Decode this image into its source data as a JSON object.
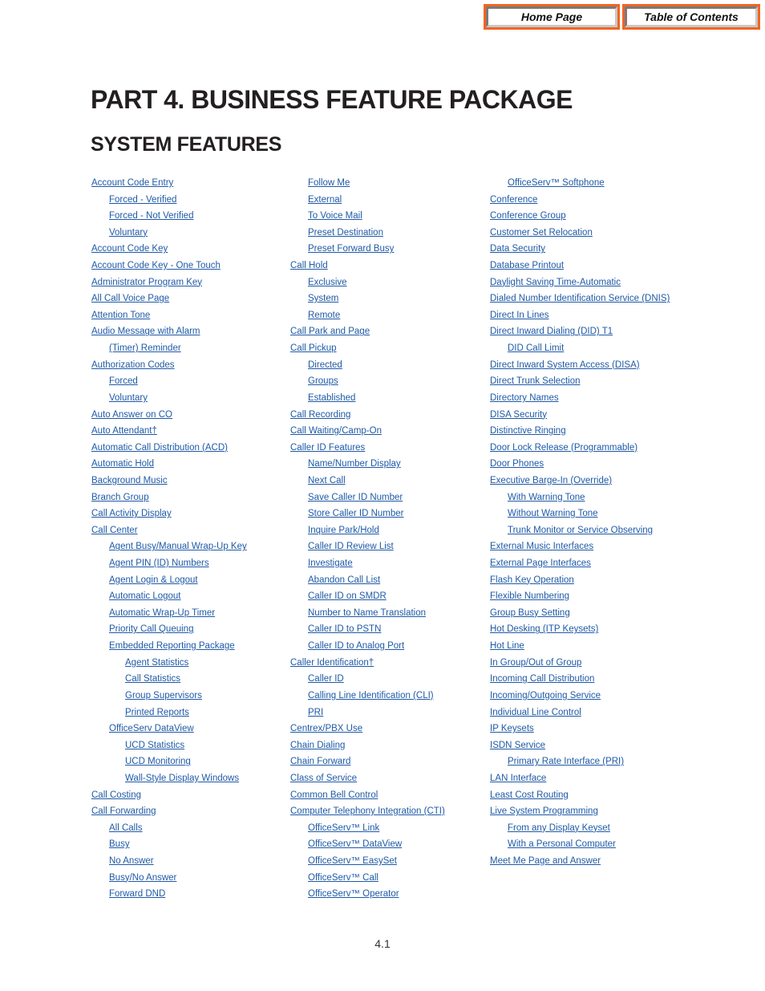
{
  "nav": {
    "home_label": "Home Page",
    "toc_label": "Table of Contents",
    "accent_color": "#f26522"
  },
  "title": "PART 4. BUSINESS FEATURE PACKAGE",
  "subtitle": "SYSTEM FEATURES",
  "link_color": "#1f5aa6",
  "columns": [
    [
      {
        "label": "Account Code Entry",
        "level": 0
      },
      {
        "label": "Forced - Verified",
        "level": 1
      },
      {
        "label": "Forced - Not Verified",
        "level": 1
      },
      {
        "label": "Voluntary",
        "level": 1
      },
      {
        "label": "Account Code Key",
        "level": 0
      },
      {
        "label": "Account Code Key - One Touch",
        "level": 0
      },
      {
        "label": "Administrator Program Key",
        "level": 0
      },
      {
        "label": "All Call Voice Page",
        "level": 0
      },
      {
        "label": "Attention Tone",
        "level": 0
      },
      {
        "label": "Audio Message with Alarm ",
        "level": 0
      },
      {
        "label": "(Timer) Reminder",
        "level": 1
      },
      {
        "label": "Authorization Codes",
        "level": 0
      },
      {
        "label": "Forced",
        "level": 1
      },
      {
        "label": "Voluntary",
        "level": 1
      },
      {
        "label": "Auto Answer on CO",
        "level": 0
      },
      {
        "label": "Auto Attendant†",
        "level": 0
      },
      {
        "label": "Automatic Call Distribution (ACD)",
        "level": 0
      },
      {
        "label": "Automatic Hold",
        "level": 0
      },
      {
        "label": "Background Music",
        "level": 0
      },
      {
        "label": "Branch Group",
        "level": 0
      },
      {
        "label": "Call Activity Display",
        "level": 0
      },
      {
        "label": "Call Center",
        "level": 0
      },
      {
        "label": "Agent Busy/Manual Wrap-Up Key",
        "level": 1
      },
      {
        "label": "Agent PIN (ID) Numbers",
        "level": 1
      },
      {
        "label": "Agent Login & Logout",
        "level": 1
      },
      {
        "label": "Automatic Logout",
        "level": 1
      },
      {
        "label": "Automatic Wrap-Up Timer",
        "level": 1
      },
      {
        "label": "Priority Call Queuing",
        "level": 1
      },
      {
        "label": "Embedded Reporting Package",
        "level": 1
      },
      {
        "label": "Agent Statistics",
        "level": 2
      },
      {
        "label": "Call Statistics",
        "level": 2
      },
      {
        "label": "Group Supervisors",
        "level": 2
      },
      {
        "label": "Printed Reports",
        "level": 2
      },
      {
        "label": "OfficeServ DataView",
        "level": 1
      },
      {
        "label": "UCD Statistics",
        "level": 2
      },
      {
        "label": "UCD Monitoring",
        "level": 2
      },
      {
        "label": "Wall-Style Display Windows",
        "level": 2
      },
      {
        "label": "Call Costing",
        "level": 0
      },
      {
        "label": "Call Forwarding",
        "level": 0
      },
      {
        "label": "All Calls",
        "level": 1
      },
      {
        "label": "Busy",
        "level": 1
      },
      {
        "label": "No Answer",
        "level": 1
      },
      {
        "label": "Busy/No Answer",
        "level": 1
      },
      {
        "label": "Forward DND",
        "level": 1
      }
    ],
    [
      {
        "label": "Follow Me",
        "level": 1
      },
      {
        "label": "External",
        "level": 1
      },
      {
        "label": "To Voice Mail",
        "level": 1
      },
      {
        "label": "Preset Destination",
        "level": 1
      },
      {
        "label": "Preset Forward Busy",
        "level": 1
      },
      {
        "label": "Call Hold",
        "level": 0
      },
      {
        "label": "Exclusive",
        "level": 1
      },
      {
        "label": "System",
        "level": 1
      },
      {
        "label": "Remote",
        "level": 1
      },
      {
        "label": "Call Park and Page",
        "level": 0
      },
      {
        "label": "Call Pickup",
        "level": 0
      },
      {
        "label": "Directed",
        "level": 1
      },
      {
        "label": "Groups",
        "level": 1
      },
      {
        "label": "Established",
        "level": 1
      },
      {
        "label": "Call Recording",
        "level": 0
      },
      {
        "label": "Call Waiting/Camp-On",
        "level": 0
      },
      {
        "label": "Caller ID Features",
        "level": 0
      },
      {
        "label": "Name/Number Display",
        "level": 1
      },
      {
        "label": "Next Call",
        "level": 1
      },
      {
        "label": "Save Caller ID Number",
        "level": 1
      },
      {
        "label": "Store Caller ID Number",
        "level": 1
      },
      {
        "label": "Inquire Park/Hold",
        "level": 1
      },
      {
        "label": "Caller ID Review List ",
        "level": 1
      },
      {
        "label": "Investigate",
        "level": 1
      },
      {
        "label": "Abandon Call List",
        "level": 1
      },
      {
        "label": "Caller ID on SMDR",
        "level": 1
      },
      {
        "label": "Number to Name Translation",
        "level": 1
      },
      {
        "label": "Caller ID to PSTN",
        "level": 1
      },
      {
        "label": "Caller ID to Analog Port",
        "level": 1
      },
      {
        "label": "Caller Identification†",
        "level": 0
      },
      {
        "label": "Caller ID",
        "level": 1
      },
      {
        "label": "Calling Line Identification (CLI)",
        "level": 1
      },
      {
        "label": "PRI",
        "level": 1
      },
      {
        "label": "Centrex/PBX Use",
        "level": 0
      },
      {
        "label": "Chain Dialing",
        "level": 0
      },
      {
        "label": "Chain Forward",
        "level": 0
      },
      {
        "label": "Class of Service",
        "level": 0
      },
      {
        "label": "Common Bell Control",
        "level": 0
      },
      {
        "label": "Computer Telephony Integration (CTI)",
        "level": 0
      },
      {
        "label": "OfficeServ™ Link",
        "level": 1
      },
      {
        "label": "OfficeServ™ DataView",
        "level": 1
      },
      {
        "label": "OfficeServ™ EasySet",
        "level": 1
      },
      {
        "label": "OfficeServ™ Call",
        "level": 1
      },
      {
        "label": "OfficeServ™ Operator",
        "level": 1
      }
    ],
    [
      {
        "label": "OfficeServ™ Softphone",
        "level": 1
      },
      {
        "label": "Conference",
        "level": 0
      },
      {
        "label": "Conference Group",
        "level": 0
      },
      {
        "label": "Customer Set Relocation",
        "level": 0
      },
      {
        "label": "Data Security",
        "level": 0
      },
      {
        "label": "Database Printout",
        "level": 0
      },
      {
        "label": "Daylight Saving Time-Automatic",
        "level": 0
      },
      {
        "label": "Dialed Number Identification Service (DNIS)",
        "level": 0
      },
      {
        "label": "Direct In Lines",
        "level": 0
      },
      {
        "label": "Direct Inward Dialing (DID) T1",
        "level": 0
      },
      {
        "label": "DID Call Limit",
        "level": 1
      },
      {
        "label": "Direct Inward System Access (DISA)",
        "level": 0
      },
      {
        "label": "Direct Trunk Selection",
        "level": 0
      },
      {
        "label": "Directory Names",
        "level": 0
      },
      {
        "label": "DISA Security",
        "level": 0
      },
      {
        "label": "Distinctive Ringing",
        "level": 0
      },
      {
        "label": "Door Lock Release (Programmable)",
        "level": 0
      },
      {
        "label": "Door Phones",
        "level": 0
      },
      {
        "label": "Executive Barge-In (Override)",
        "level": 0
      },
      {
        "label": "With Warning Tone",
        "level": 1
      },
      {
        "label": "Without Warning Tone",
        "level": 1
      },
      {
        "label": "Trunk Monitor or Service Observing",
        "level": 1
      },
      {
        "label": "External Music Interfaces ",
        "level": 0
      },
      {
        "label": "External Page Interfaces",
        "level": 0
      },
      {
        "label": "Flash Key Operation",
        "level": 0
      },
      {
        "label": "Flexible Numbering",
        "level": 0
      },
      {
        "label": "Group Busy Setting",
        "level": 0
      },
      {
        "label": "Hot Desking (ITP Keysets)",
        "level": 0
      },
      {
        "label": "Hot Line",
        "level": 0
      },
      {
        "label": "In Group/Out of Group",
        "level": 0
      },
      {
        "label": "Incoming Call Distribution",
        "level": 0
      },
      {
        "label": "Incoming/Outgoing Service",
        "level": 0
      },
      {
        "label": "Individual Line Control",
        "level": 0
      },
      {
        "label": "IP Keysets",
        "level": 0
      },
      {
        "label": "ISDN Service",
        "level": 0
      },
      {
        "label": "Primary Rate Interface (PRI)",
        "level": 1
      },
      {
        "label": "LAN Interface",
        "level": 0
      },
      {
        "label": "Least Cost Routing",
        "level": 0
      },
      {
        "label": "Live System Programming",
        "level": 0
      },
      {
        "label": "From any Display Keyset",
        "level": 1
      },
      {
        "label": "With a Personal Computer",
        "level": 1
      },
      {
        "label": "Meet Me Page and Answer",
        "level": 0
      }
    ]
  ],
  "page_number": "4.1"
}
